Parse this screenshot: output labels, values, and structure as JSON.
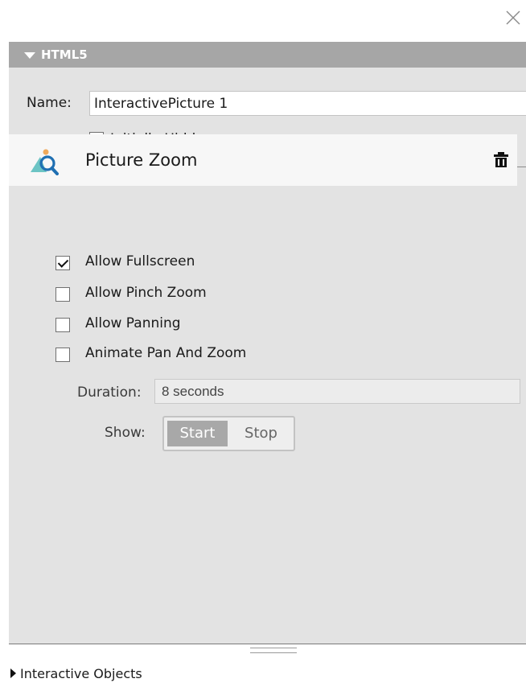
{
  "dialog": {
    "close_icon": "close-icon"
  },
  "html5_panel": {
    "title": "HTML5",
    "name_label": "Name:",
    "name_value": "InteractivePicture 1",
    "initially_hidden": {
      "label": "Initially Hidden",
      "checked": false
    }
  },
  "picture_zoom": {
    "title": "Picture Zoom",
    "icon": "picture-zoom-icon",
    "delete_icon": "trash-icon",
    "options": [
      {
        "label": "Allow Fullscreen",
        "checked": true
      },
      {
        "label": "Allow Pinch Zoom",
        "checked": false
      },
      {
        "label": "Allow Panning",
        "checked": false
      },
      {
        "label": "Animate Pan And Zoom",
        "checked": false
      }
    ],
    "duration_label": "Duration:",
    "duration_value": "8 seconds",
    "show_label": "Show:",
    "show_options": [
      "Start",
      "Stop"
    ],
    "show_selected": "Start"
  },
  "footer": {
    "label": "Interactive Objects"
  },
  "colors": {
    "panel_bg": "#e3e3e3",
    "header_bg": "#a6a6a6",
    "icon_teal": "#4fb3b3",
    "icon_blue": "#1f6fb2"
  }
}
